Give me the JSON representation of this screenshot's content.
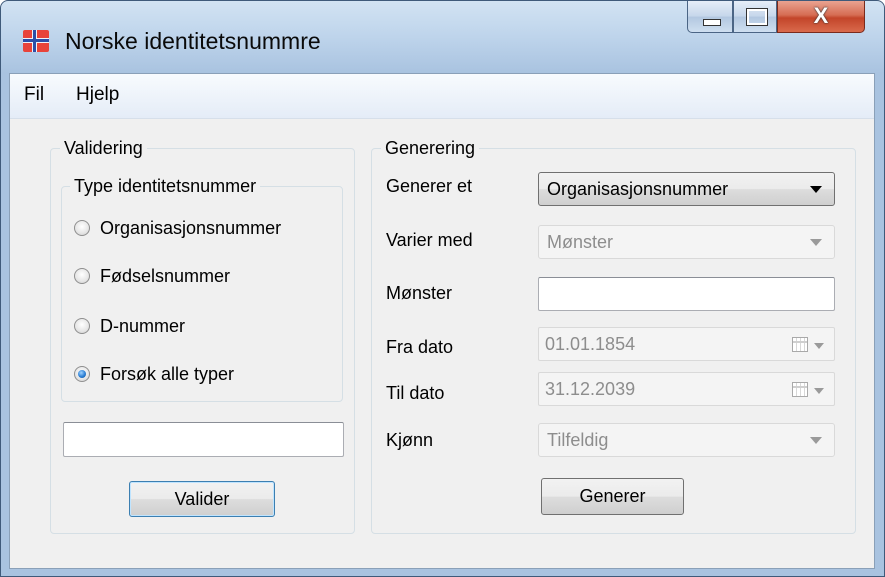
{
  "window": {
    "title": "Norske identitetsnummre",
    "icon": "flag-icon",
    "controls": [
      "minimize-icon",
      "maximize-icon",
      "close-icon"
    ],
    "close_glyph": "X"
  },
  "menu": {
    "file": "Fil",
    "help": "Hjelp"
  },
  "validering": {
    "legend": "Validering",
    "type_group": {
      "legend": "Type identitetsnummer",
      "options": [
        {
          "label": "Organisasjonsnummer",
          "checked": false
        },
        {
          "label": "Fødselsnummer",
          "checked": false
        },
        {
          "label": "D-nummer",
          "checked": false
        },
        {
          "label": "Forsøk alle typer",
          "checked": true
        }
      ]
    },
    "input_value": "",
    "button": "Valider"
  },
  "generering": {
    "legend": "Generering",
    "generer_et": {
      "label": "Generer et",
      "value": "Organisasjonsnummer"
    },
    "varier_med": {
      "label": "Varier med",
      "value": "Mønster"
    },
    "monster": {
      "label": "Mønster",
      "value": ""
    },
    "fra_dato": {
      "label": "Fra dato",
      "value": "01.01.1854"
    },
    "til_dato": {
      "label": "Til dato",
      "value": "31.12.2039"
    },
    "kjonn": {
      "label": "Kjønn",
      "value": "Tilfeldig"
    },
    "button": "Generer"
  },
  "colors": {
    "titlebar": "#bed4eb",
    "client": "#f0f0f0",
    "close_button": "#c3452a",
    "radio_checked": "#2c7fd4"
  }
}
